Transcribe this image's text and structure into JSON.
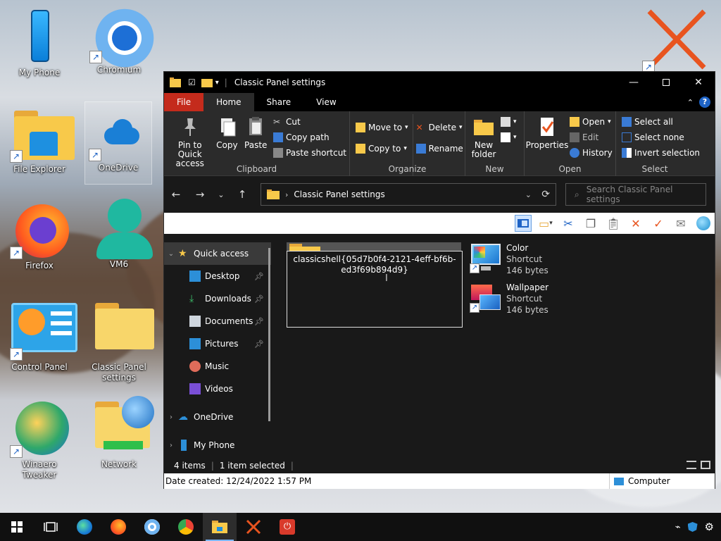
{
  "desktop": {
    "icons": [
      {
        "label": "My Phone"
      },
      {
        "label": "Chromium"
      },
      {
        "label": "File Explorer"
      },
      {
        "label": "OneDrive"
      },
      {
        "label": "Firefox"
      },
      {
        "label": "VM6"
      },
      {
        "label": "Control Panel"
      },
      {
        "label": "Classic Panel settings"
      },
      {
        "label": "Winaero Tweaker"
      },
      {
        "label": "Network"
      }
    ]
  },
  "window": {
    "title": "Classic Panel settings",
    "tabs": {
      "file": "File",
      "home": "Home",
      "share": "Share",
      "view": "View"
    },
    "ribbon": {
      "clipboard": {
        "label": "Clipboard",
        "pin": "Pin to Quick access",
        "copy": "Copy",
        "paste": "Paste",
        "cut": "Cut",
        "copy_path": "Copy path",
        "paste_shortcut": "Paste shortcut"
      },
      "organize": {
        "label": "Organize",
        "move_to": "Move to",
        "copy_to": "Copy to",
        "delete": "Delete",
        "rename": "Rename"
      },
      "new": {
        "label": "New",
        "new_folder": "New folder"
      },
      "open": {
        "label": "Open",
        "properties": "Properties",
        "open": "Open",
        "edit": "Edit",
        "history": "History"
      },
      "select": {
        "label": "Select",
        "select_all": "Select all",
        "select_none": "Select none",
        "invert": "Invert selection"
      }
    },
    "address": {
      "path": "Classic Panel settings",
      "search_placeholder": "Search Classic Panel settings"
    },
    "nav": {
      "quick_access": "Quick access",
      "desktop": "Desktop",
      "downloads": "Downloads",
      "documents": "Documents",
      "pictures": "Pictures",
      "music": "Music",
      "videos": "Videos",
      "onedrive": "OneDrive",
      "my_phone": "My Phone"
    },
    "content": {
      "rename_text": "classicshell{05d7b0f4-2121-4eff-bf6b-ed3f69b894d9}",
      "files": [
        {
          "name": "Color",
          "type": "Shortcut",
          "size": "146 bytes"
        },
        {
          "name": "Wallpaper",
          "type": "Shortcut",
          "size": "146 bytes"
        }
      ]
    },
    "status": {
      "items": "4 items",
      "selected": "1 item selected"
    },
    "details": {
      "date_created": "Date created: 12/24/2022 1:57 PM",
      "location": "Computer"
    }
  },
  "colors": {
    "file_tab": "#c42b1c",
    "accent": "#1e90ff",
    "folder": "#f8c94a"
  }
}
